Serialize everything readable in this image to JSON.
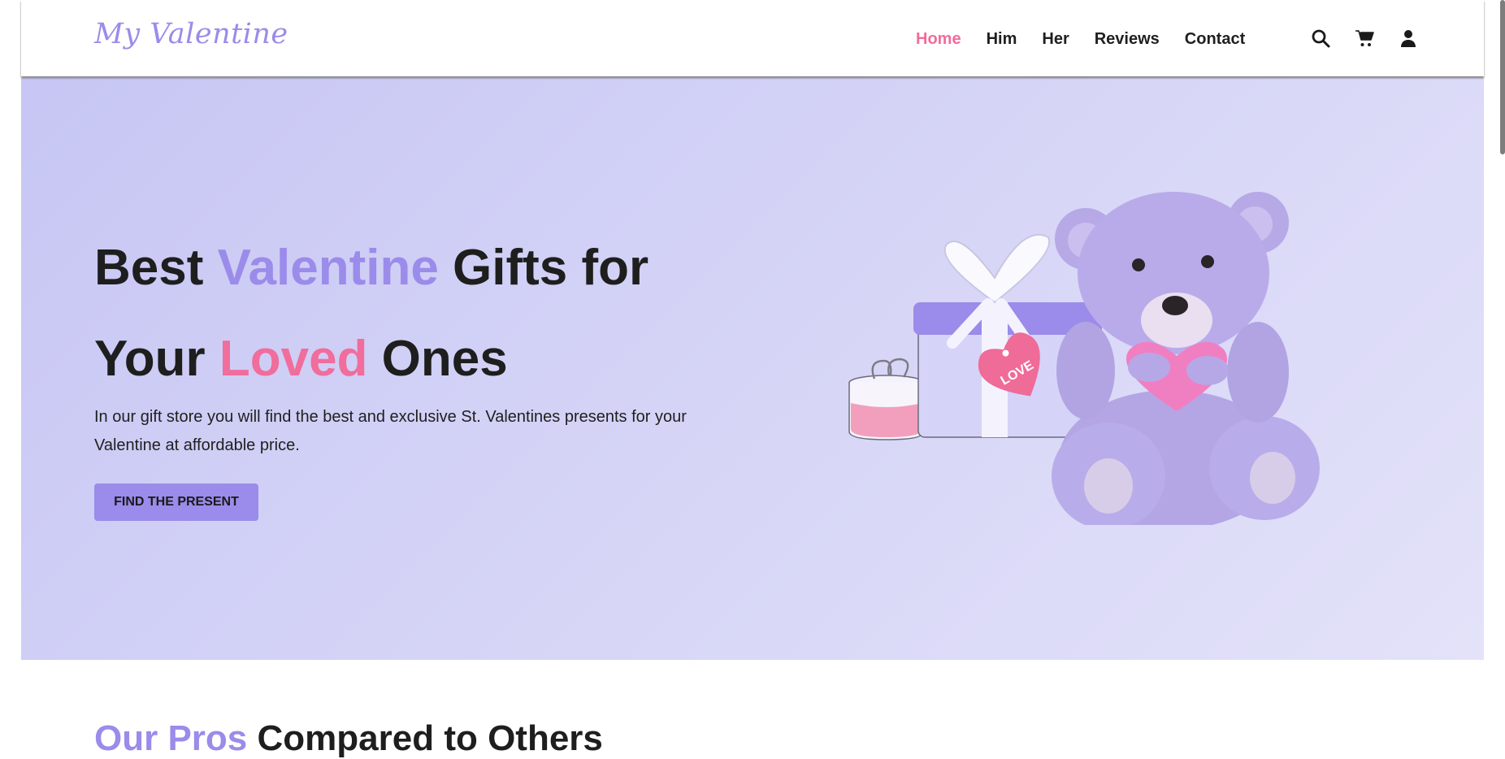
{
  "brand": {
    "logo": "My Valentine",
    "accent": "#9b8bea",
    "pink": "#f06d9c"
  },
  "nav": {
    "items": [
      {
        "label": "Home",
        "active": true
      },
      {
        "label": "Him"
      },
      {
        "label": "Her"
      },
      {
        "label": "Reviews"
      },
      {
        "label": "Contact"
      }
    ]
  },
  "tools": {
    "icons": [
      "search-icon",
      "cart-icon",
      "user-icon"
    ]
  },
  "hero": {
    "title_part1": "Best ",
    "title_highlight1": "Valentine",
    "title_part2": " Gifts for",
    "title_part3": "Your ",
    "title_highlight2": "Loved",
    "title_part4": " Ones",
    "description": "In our gift store you will find the best and exclusive St. Valentines presents for your Valentine at affordable price.",
    "cta_label": "FIND THE PRESENT",
    "tag_text": "LOVE"
  },
  "section": {
    "title_highlight": "Our Pros",
    "title_rest": " Compared to Others"
  }
}
